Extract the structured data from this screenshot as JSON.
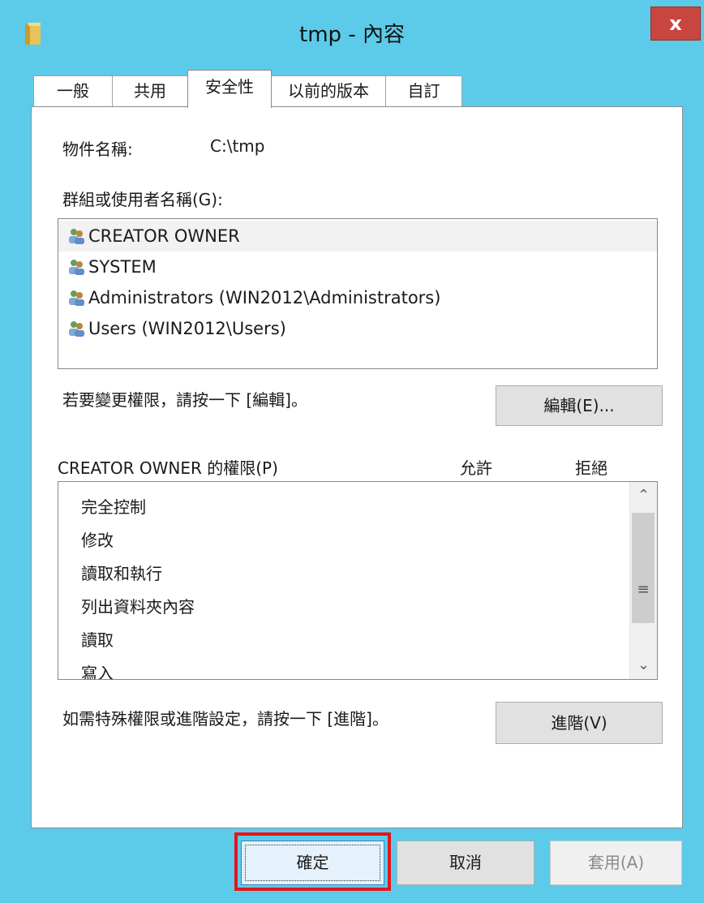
{
  "window": {
    "title": "tmp - 內容",
    "close_label": "x"
  },
  "tabs": [
    {
      "label": "一般"
    },
    {
      "label": "共用"
    },
    {
      "label": "安全性"
    },
    {
      "label": "以前的版本"
    },
    {
      "label": "自訂"
    }
  ],
  "security": {
    "object_name_label": "物件名稱:",
    "object_name_value": "C:\\tmp",
    "groups_label": "群組或使用者名稱(G):",
    "principals": [
      {
        "name": "CREATOR OWNER",
        "icon": "users-group-icon"
      },
      {
        "name": "SYSTEM",
        "icon": "users-group-icon"
      },
      {
        "name": "Administrators (WIN2012\\Administrators)",
        "icon": "users-group-icon"
      },
      {
        "name": "Users (WIN2012\\Users)",
        "icon": "users-group-icon"
      }
    ],
    "edit_hint": "若要變更權限，請按一下 [編輯]。",
    "edit_button": "編輯(E)...",
    "perm_title": "CREATOR OWNER 的權限(P)",
    "allow_header": "允許",
    "deny_header": "拒絕",
    "permissions": [
      "完全控制",
      "修改",
      "讀取和執行",
      "列出資料夾內容",
      "讀取",
      "寫入"
    ],
    "advanced_hint": "如需特殊權限或進階設定，請按一下 [進階]。",
    "advanced_button": "進階(V)"
  },
  "footer": {
    "ok": "確定",
    "cancel": "取消",
    "apply": "套用(A)"
  },
  "colors": {
    "title_bar": "#5ccbe9",
    "close": "#c8463f",
    "highlight": "#e8141b"
  }
}
